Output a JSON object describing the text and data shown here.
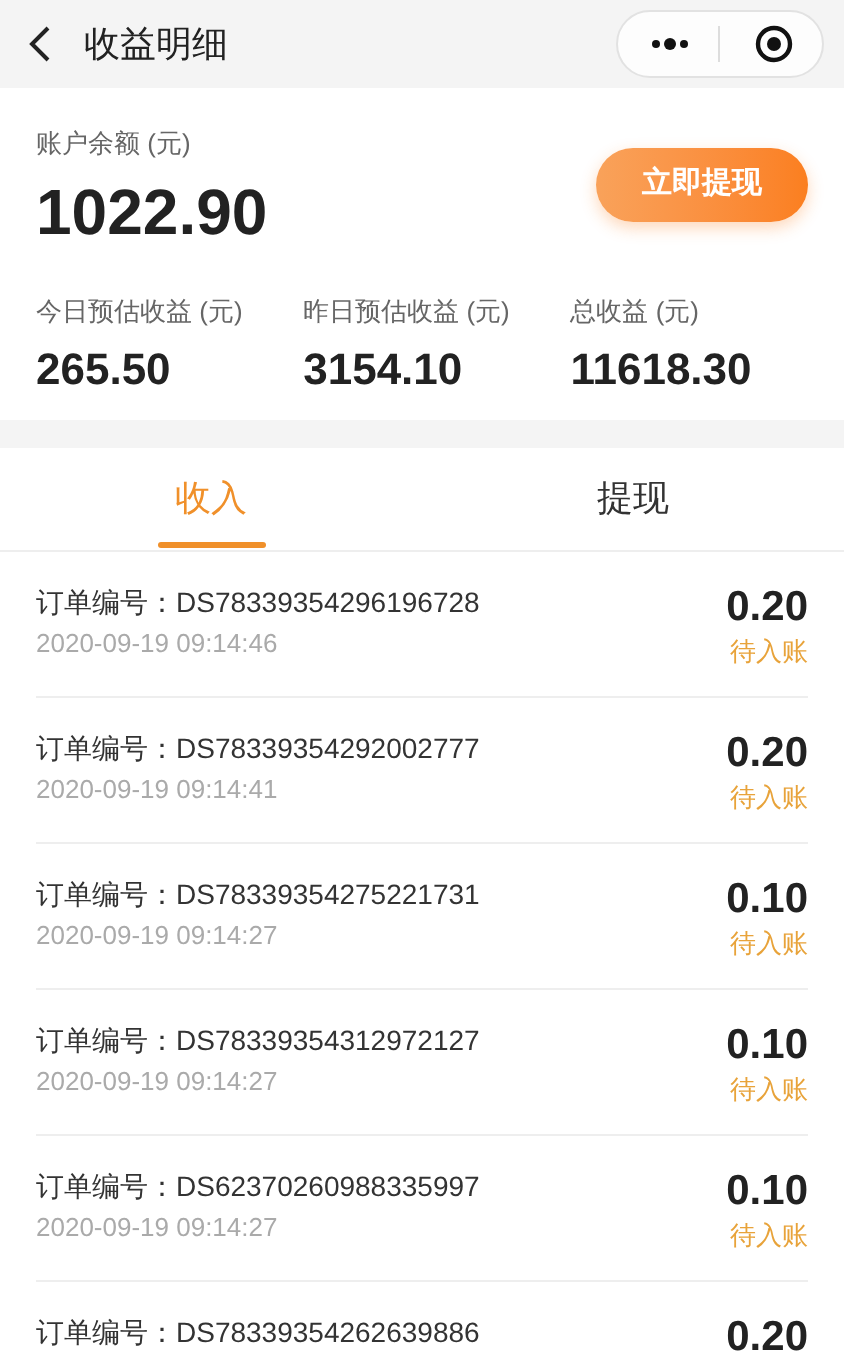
{
  "nav": {
    "title": "收益明细"
  },
  "balance": {
    "label": "账户余额 (元)",
    "value": "1022.90",
    "button": "立即提现"
  },
  "stats": [
    {
      "label": "今日预估收益 (元)",
      "value": "265.50"
    },
    {
      "label": "昨日预估收益 (元)",
      "value": "3154.10"
    },
    {
      "label": "总收益 (元)",
      "value": "11618.30"
    }
  ],
  "tabs": [
    {
      "label": "收入",
      "selected": true
    },
    {
      "label": "提现",
      "selected": false
    }
  ],
  "records": [
    {
      "order": "订单编号：DS78339354296196728",
      "time": "2020-09-19 09:14:46",
      "amount": "0.20",
      "status": "待入账"
    },
    {
      "order": "订单编号：DS78339354292002777",
      "time": "2020-09-19 09:14:41",
      "amount": "0.20",
      "status": "待入账"
    },
    {
      "order": "订单编号：DS78339354275221731",
      "time": "2020-09-19 09:14:27",
      "amount": "0.10",
      "status": "待入账"
    },
    {
      "order": "订单编号：DS78339354312972127",
      "time": "2020-09-19 09:14:27",
      "amount": "0.10",
      "status": "待入账"
    },
    {
      "order": "订单编号：DS62370260988335997",
      "time": "2020-09-19 09:14:27",
      "amount": "0.10",
      "status": "待入账"
    },
    {
      "order": "订单编号：DS78339354262639886",
      "amount": "0.20"
    }
  ]
}
